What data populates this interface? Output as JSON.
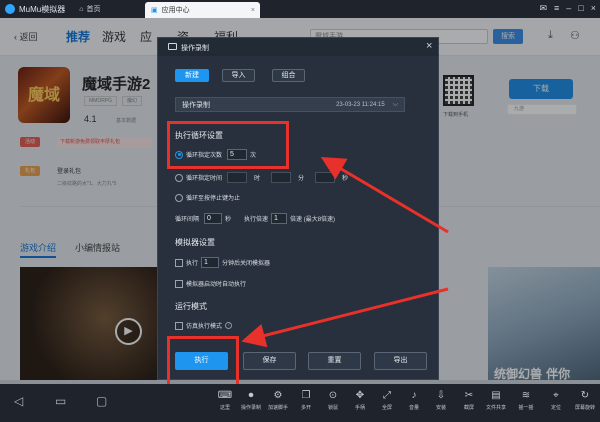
{
  "window": {
    "app_title": "MuMu模拟器",
    "home_label": "首页",
    "tab_title": "应用中心"
  },
  "nav": {
    "back_label": "返回",
    "items": [
      "推荐",
      "游戏",
      "应",
      "资",
      "福利"
    ],
    "search_value": "魔域手游",
    "search_button": "搜索"
  },
  "app": {
    "icon_text": "魔域",
    "name": "魔域手游2",
    "tags": [
      "MMORPG",
      "魔幻"
    ],
    "rating": "4.1",
    "rating_label": "基本数据",
    "label_good": "活动",
    "promo_text": "下载新游免费领取丰厚礼包",
    "label_gift": "礼包",
    "gift_title": "登录礼包",
    "gift_desc": "二级纹路的水*1、大力丸*5",
    "gift_button": "领取",
    "download_button": "下载",
    "download_sub": "九游",
    "qr_label": "下载到手机"
  },
  "tabs": {
    "intro": "游戏介绍",
    "editor": "小编情报站"
  },
  "media": {
    "art_text": "统御幻兽 伴你"
  },
  "dialog": {
    "title": "操作录制",
    "segments": [
      "新建",
      "导入",
      "组合"
    ],
    "recording_name": "操作录制",
    "recording_time": "23-03-23 11:24:15",
    "loop_section": "执行循环设置",
    "loop_count_label": "循环指定次数",
    "loop_count_value": "5",
    "loop_count_unit": "次",
    "loop_time_label": "循环指定时间",
    "time_h_unit": "时",
    "time_m_unit": "分",
    "time_s_unit": "秒",
    "loop_until_label": "循环至按停止键为止",
    "interval_label": "循环间隔",
    "interval_value": "0",
    "interval_unit": "秒",
    "speed_label": "执行倍速",
    "speed_value": "1",
    "speed_unit": "倍速 (最大8倍速)",
    "emulator_section": "模拟器设置",
    "exec_label": "执行",
    "exec_value": "1",
    "exec_unit": "分钟后关闭模拟器",
    "autostart_label": "模拟器启动时自动执行",
    "mode_section": "运行模式",
    "sim_mode_label": "仿真执行模式",
    "buttons": {
      "run": "执行",
      "save": "保存",
      "reset": "重置",
      "export": "导出"
    }
  },
  "bottom": {
    "items": [
      "这里",
      "操作录制",
      "加速脚手",
      "多开",
      "锁鼠",
      "手柄",
      "全屏",
      "音量",
      "安装",
      "截屏",
      "文件共享",
      "摇一摇",
      "定位",
      "屏幕旋转"
    ]
  },
  "colors": {
    "accent": "#1e96f0",
    "annotation": "#e8312a"
  }
}
